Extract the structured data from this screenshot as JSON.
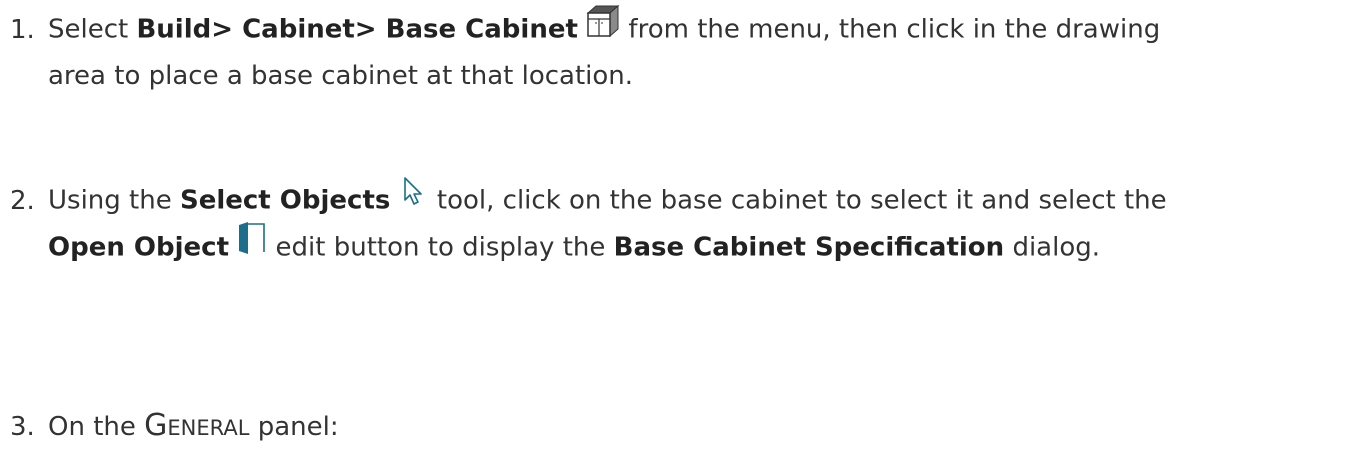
{
  "steps": [
    {
      "number": "1.",
      "line1_pre": "Select ",
      "line1_bold": "Build> Cabinet> Base Cabinet",
      "line1_icon": "base-cabinet-icon",
      "line1_post": " from the menu, then click in the drawing",
      "line2": "area to place a base cabinet at that location."
    },
    {
      "number": "2.",
      "line1_pre": "Using the ",
      "line1_bold": "Select Objects",
      "line1_icon": "select-arrow-icon",
      "line1_post": " tool, click on the base cabinet to select it and select the",
      "line2_bold1": "Open Object",
      "line2_icon": "open-object-icon",
      "line2_mid": " edit button to display the ",
      "line2_bold2": "Base Cabinet Specification",
      "line2_post": " dialog."
    },
    {
      "number": "3.",
      "line1_pre": "On the ",
      "line1_sc_big": "G",
      "line1_sc_small": "ENERAL",
      "line1_post": " panel:"
    }
  ],
  "colors": {
    "text": "#333333",
    "icon_teal": "#1c6e8c"
  }
}
